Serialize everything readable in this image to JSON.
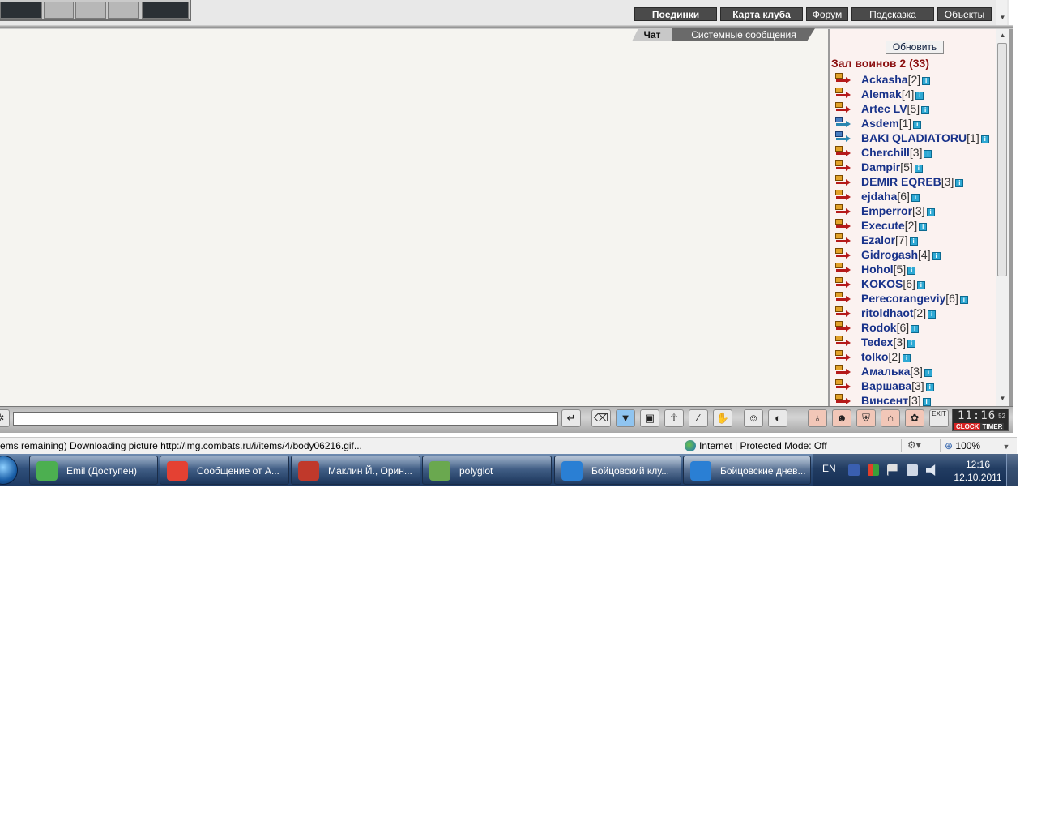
{
  "nav": {
    "buttons": [
      "Поединки",
      "Карта клуба",
      "Форум",
      "Подсказка",
      "Объекты"
    ]
  },
  "chat": {
    "tabs": [
      "Чат",
      "Системные сообщения"
    ],
    "input_value": ""
  },
  "users": {
    "refresh_label": "Обновить",
    "room_title": "Зал воинов 2 (33)",
    "info_glyph": "i",
    "list": [
      {
        "name": "Ackasha",
        "level": "[2]",
        "icon": "red-arrow-icon"
      },
      {
        "name": "Alemak",
        "level": "[4]",
        "icon": "red-arrow-icon"
      },
      {
        "name": "Artec LV",
        "level": "[5]",
        "icon": "red-arrow-icon"
      },
      {
        "name": "Asdem",
        "level": "[1]",
        "icon": "blue-arrow-icon"
      },
      {
        "name": "BAKI QLADIATORU",
        "level": "[1]",
        "icon": "blue-arrow-icon"
      },
      {
        "name": "Cherchill",
        "level": "[3]",
        "icon": "red-arrow-icon"
      },
      {
        "name": "Dampir",
        "level": "[5]",
        "icon": "red-arrow-icon"
      },
      {
        "name": "DEMIR EQREB",
        "level": "[3]",
        "icon": "red-arrow-icon"
      },
      {
        "name": "ejdaha",
        "level": "[6]",
        "icon": "red-arrow-icon"
      },
      {
        "name": "Emperror",
        "level": "[3]",
        "icon": "red-arrow-icon"
      },
      {
        "name": "Execute",
        "level": "[2]",
        "icon": "red-arrow-icon"
      },
      {
        "name": "Ezalor",
        "level": "[7]",
        "icon": "red-arrow-icon"
      },
      {
        "name": "Gidrogash",
        "level": "[4]",
        "icon": "red-arrow-icon"
      },
      {
        "name": "Hohol",
        "level": "[5]",
        "icon": "red-arrow-icon"
      },
      {
        "name": "KOKOS",
        "level": "[6]",
        "icon": "red-arrow-icon"
      },
      {
        "name": "Perecorangeviy",
        "level": "[6]",
        "icon": "red-arrow-icon"
      },
      {
        "name": "ritoldhaot",
        "level": "[2]",
        "icon": "red-arrow-icon"
      },
      {
        "name": "Rodok",
        "level": "[6]",
        "icon": "red-arrow-icon"
      },
      {
        "name": "Tedex",
        "level": "[3]",
        "icon": "red-arrow-icon"
      },
      {
        "name": "tolko",
        "level": "[2]",
        "icon": "red-arrow-icon"
      },
      {
        "name": "Амалька",
        "level": "[3]",
        "icon": "red-arrow-icon"
      },
      {
        "name": "Варшава",
        "level": "[3]",
        "icon": "red-arrow-icon"
      },
      {
        "name": "Винсент",
        "level": "[3]",
        "icon": "red-arrow-icon"
      }
    ]
  },
  "toolbar": {
    "icons": [
      "gear-icon",
      "enter-icon",
      "eraser-icon",
      "filter-icon",
      "save-icon",
      "fighter-icon",
      "split-icon",
      "hands-icon",
      "smiley-icon",
      "helmet-icon"
    ],
    "right_icons": [
      "bag-icon",
      "mask-icon",
      "armor-icon",
      "house-icon",
      "flower-icon",
      "exit-icon"
    ],
    "exit_label": "EXIT",
    "clock_time": "11:16",
    "clock_seconds": "52",
    "clock_label": "CLOCK",
    "timer_label": "TIMER"
  },
  "statusbar": {
    "text": "ems remaining) Downloading picture http://img.combats.ru/i/items/4/body06216.gif...",
    "zone": "Internet | Protected Mode: Off",
    "zoom": "100%"
  },
  "taskbar": {
    "items": [
      {
        "label": "Emil (Доступен)",
        "icon": "messenger-icon",
        "color": "#4caf50"
      },
      {
        "label": "Сообщение от А...",
        "icon": "chrome-icon",
        "color": "#e44133"
      },
      {
        "label": "Маклин Й., Орин...",
        "icon": "pdf-icon",
        "color": "#c0392b"
      },
      {
        "label": "polyglot",
        "icon": "graduation-cap-icon",
        "color": "#6aa84f"
      },
      {
        "label": "Бойцовский клу...",
        "icon": "ie-icon",
        "color": "#2a7fd4"
      },
      {
        "label": "Бойцовские днев...",
        "icon": "ie-icon",
        "color": "#2a7fd4"
      }
    ],
    "lang": "EN",
    "time": "12:16",
    "date": "12.10.2011"
  }
}
